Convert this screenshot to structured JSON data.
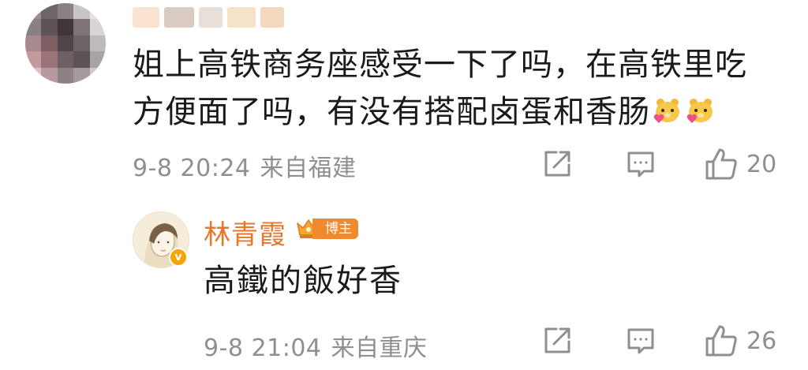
{
  "comment": {
    "text_lines": [
      "姐上高铁商务座感受一下了吗，在高铁里吃",
      "方便面了吗，有没有搭配卤蛋和香肠"
    ],
    "emoji": [
      "bear-heart-emoji",
      "bear-heart-emoji"
    ],
    "timestamp": "9-8 20:24",
    "source": "来自福建",
    "like_count": "20",
    "actions": [
      "share-icon",
      "reply-icon",
      "like-icon"
    ]
  },
  "reply": {
    "author": "林青霞",
    "badge_label": "博主",
    "verified": "v",
    "text": "高鐵的飯好香",
    "timestamp": "9-8 21:04",
    "source": "来自重庆",
    "like_count": "26",
    "actions": [
      "share-icon",
      "reply-icon",
      "like-icon"
    ]
  },
  "colors": {
    "author_name": "#e8752c",
    "badge": "#f08a2c",
    "meta_gray": "#8f8f8f",
    "text": "#1a1a1a"
  }
}
